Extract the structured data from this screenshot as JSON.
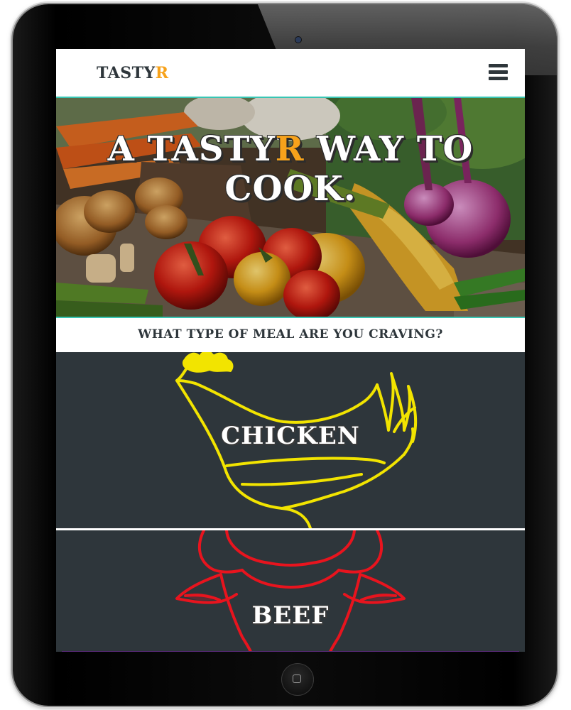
{
  "app": {
    "brand_main": "TASTY",
    "brand_accent": "R"
  },
  "hero": {
    "title_part1": "A TASTY",
    "title_accent": "R",
    "title_part2": " WAY TO COOK."
  },
  "prompt": {
    "text": "WHAT TYPE OF MEAL ARE YOU CRAVING?"
  },
  "meals": [
    {
      "label": "CHICKEN",
      "icon": "chicken-icon",
      "color": "#f2e400"
    },
    {
      "label": "BEEF",
      "icon": "bull-icon",
      "color": "#e8141e"
    }
  ],
  "colors": {
    "accent": "#f7a21b",
    "dark": "#2e363b",
    "teal": "#38c6b4"
  },
  "icons": {
    "menu": "hamburger-icon"
  }
}
